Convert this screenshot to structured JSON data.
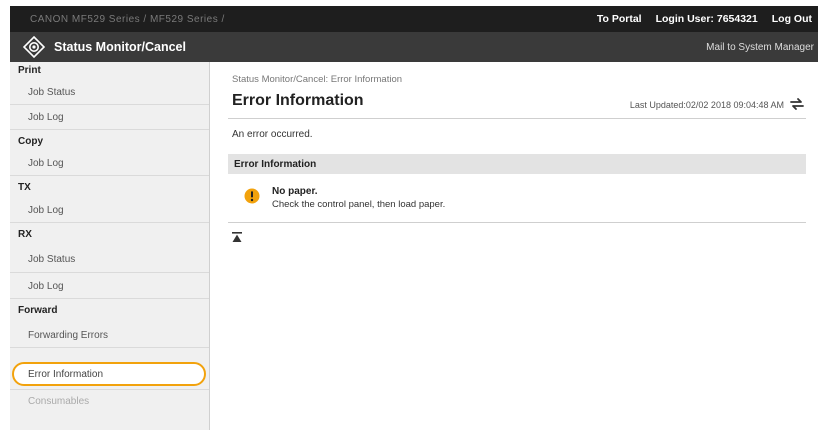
{
  "header": {
    "device_path": "CANON  MF529 Series / MF529 Series /",
    "portal_link": "To Portal",
    "login_user_label": "Login User:",
    "login_user_value": "7654321",
    "logout_link": "Log Out"
  },
  "titlebar": {
    "title": "Status Monitor/Cancel",
    "mail_link": "Mail to System Manager"
  },
  "sidebar": {
    "items": [
      {
        "type": "group",
        "label": "Print"
      },
      {
        "type": "link",
        "label": "Job Status"
      },
      {
        "type": "link",
        "label": "Job Log"
      },
      {
        "type": "group",
        "label": "Copy"
      },
      {
        "type": "link",
        "label": "Job Log"
      },
      {
        "type": "group",
        "label": "TX"
      },
      {
        "type": "link",
        "label": "Job Log"
      },
      {
        "type": "group",
        "label": "RX"
      },
      {
        "type": "link",
        "label": "Job Status"
      },
      {
        "type": "link",
        "label": "Job Log"
      },
      {
        "type": "group",
        "label": "Forward"
      },
      {
        "type": "link",
        "label": "Forwarding Errors"
      },
      {
        "type": "link",
        "label": "Error Information",
        "selected": true
      },
      {
        "type": "link",
        "label": "Consumables",
        "disabled": true
      }
    ]
  },
  "main": {
    "breadcrumb": "Status Monitor/Cancel: Error Information",
    "page_title": "Error Information",
    "last_updated": "Last Updated:02/02 2018 09:04:48 AM",
    "message": "An error occurred.",
    "section_title": "Error Information",
    "error_title": "No paper.",
    "error_description": "Check the control panel, then load paper."
  },
  "colors": {
    "topbar": "#1e1e1e",
    "titlebar": "#3a3a3a",
    "sidebar_bg": "#f0f0f0",
    "selected_outline": "#f2a20c",
    "error_icon": "#f2a20c",
    "section_bg": "#e3e3e3"
  }
}
